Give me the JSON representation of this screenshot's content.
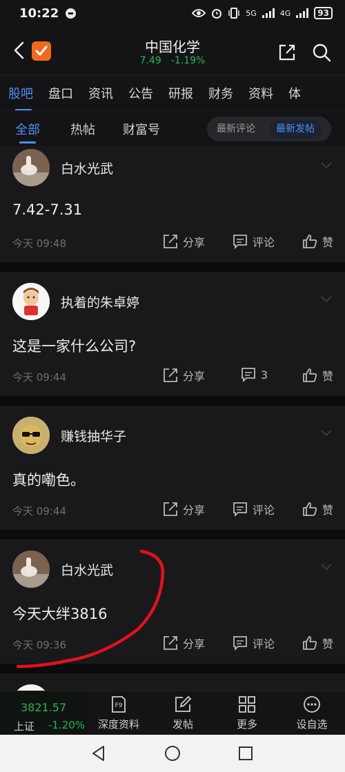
{
  "status": {
    "time": "10:22",
    "net1": "5G",
    "net2": "4G",
    "battery": "93"
  },
  "header": {
    "title": "中国化学",
    "price": "7.49",
    "change": "-1.19%"
  },
  "main_tabs": [
    "股吧",
    "盘口",
    "资讯",
    "公告",
    "研报",
    "财务",
    "资料",
    "体"
  ],
  "sub_tabs": [
    "全部",
    "热帖",
    "财富号"
  ],
  "sort": {
    "option1": "最新评论",
    "option2": "最新发帖"
  },
  "posts": [
    {
      "author": "白水光武",
      "text": "7.42-7.31",
      "time": "今天 09:48",
      "share": "分享",
      "comment": "评论",
      "like": "赞"
    },
    {
      "author": "执着的朱卓婷",
      "text": "这是一家什么公司?",
      "time": "今天 09:44",
      "share": "分享",
      "comment": "3",
      "like": "赞"
    },
    {
      "author": "赚钱抽华子",
      "text": "真的嘞色。",
      "time": "今天 09:44",
      "share": "分享",
      "comment": "评论",
      "like": "赞"
    },
    {
      "author": "白水光武",
      "text": "今天大绊3816",
      "time": "今天 09:36",
      "share": "分享",
      "comment": "评论",
      "like": "赞"
    }
  ],
  "bottom": {
    "index_value": "3821.57",
    "index_name": "上证",
    "index_change": "-1.20%",
    "f9_icon_text": "F9",
    "items": [
      "深度资料",
      "发帖",
      "更多",
      "设自选"
    ]
  },
  "colors": {
    "accent": "#4f8ff0",
    "down": "#2bb35a",
    "annotation": "#e0121b"
  }
}
